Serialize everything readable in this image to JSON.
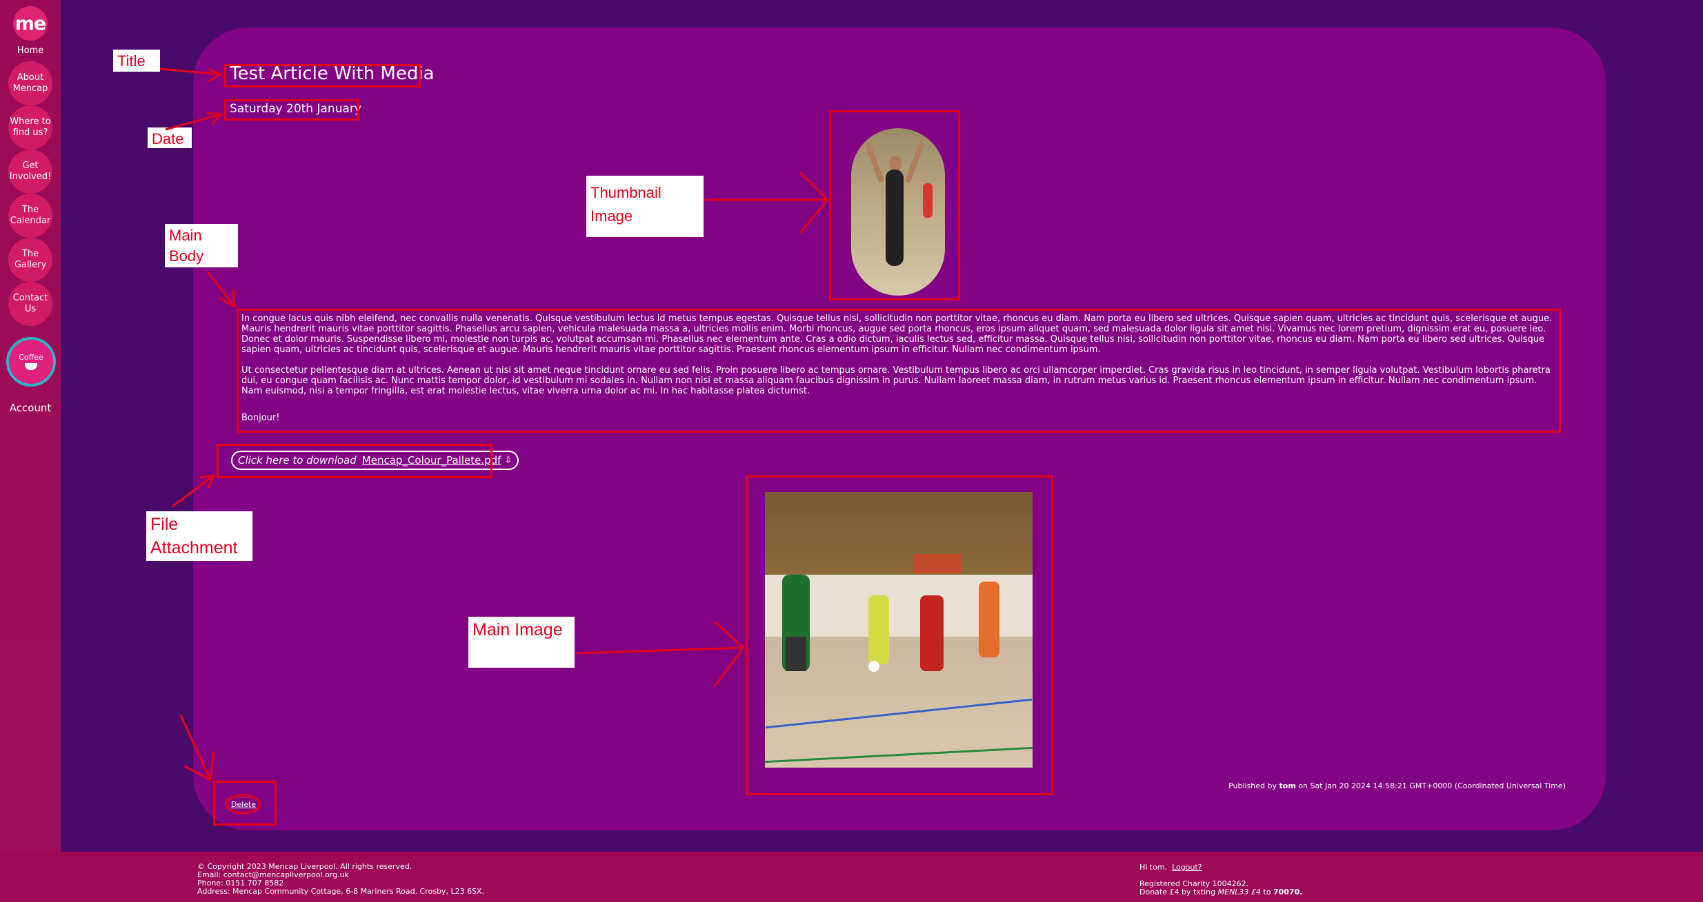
{
  "sidebar": {
    "logo": "me",
    "home_label": "Home",
    "items": [
      {
        "label": "About Mencap"
      },
      {
        "label": "Where to find us?"
      },
      {
        "label": "Get Involved!"
      },
      {
        "label": "The Calendar"
      },
      {
        "label": "The Gallery"
      },
      {
        "label": "Contact Us"
      }
    ],
    "coffee_badge": "Coffee",
    "account_label": "Account"
  },
  "article": {
    "title": "Test Article With Media",
    "date": "Saturday 20th January",
    "body_paragraphs": [
      "In congue lacus quis nibh eleifend, nec convallis nulla venenatis. Quisque vestibulum lectus id metus tempus egestas. Quisque tellus nisi, sollicitudin non porttitor vitae, rhoncus eu diam. Nam porta eu libero sed ultrices. Quisque sapien quam, ultricies ac tincidunt quis, scelerisque et augue. Mauris hendrerit mauris vitae porttitor sagittis. Phasellus arcu sapien, vehicula malesuada massa a, ultricies mollis enim. Morbi rhoncus, augue sed porta rhoncus, eros ipsum aliquet quam, sed malesuada dolor ligula sit amet nisi. Vivamus nec lorem pretium, dignissim erat eu, posuere leo. Donec et dolor mauris. Suspendisse libero mi, molestie non turpis ac, volutpat accumsan mi. Phasellus nec elementum ante. Cras a odio dictum, iaculis lectus sed, efficitur massa. Quisque tellus nisi, sollicitudin non porttitor vitae, rhoncus eu diam. Nam porta eu libero sed ultrices. Quisque sapien quam, ultricies ac tincidunt quis, scelerisque et augue. Mauris hendrerit mauris vitae porttitor sagittis. Praesent rhoncus elementum ipsum in efficitur. Nullam nec condimentum ipsum.",
      "Ut consectetur pellentesque diam at ultrices. Aenean ut nisi sit amet neque tincidunt ornare eu sed felis. Proin posuere libero ac tempus ornare. Vestibulum tempus libero ac orci ullamcorper imperdiet. Cras gravida risus in leo tincidunt, in semper ligula volutpat. Vestibulum lobortis pharetra dui, eu congue quam facilisis ac. Nunc mattis tempor dolor, id vestibulum mi sodales in. Nullam non nisi et massa aliquam faucibus dignissim in purus. Nullam laoreet massa diam, in rutrum metus varius id. Praesent rhoncus elementum ipsum in efficitur. Nullam nec condimentum ipsum. Nam euismod, nisi a tempor fringilla, est erat molestie lectus, vitae viverra urna dolor ac mi. In hac habitasse platea dictumst.",
      "Bonjour!"
    ],
    "download_lead": "Click here to download",
    "download_file": "Mencap_Colour_Pallete.pdf",
    "download_icon": "⇩",
    "published_prefix": "Published by",
    "published_author": "tom",
    "published_suffix": "on Sat Jan 20 2024 14:58:21 GMT+0000 (Coordinated Universal Time)",
    "delete_label": "Delete"
  },
  "annotations": {
    "title": "Title",
    "date": "Date",
    "thumbnail": "Thumbnail Image",
    "main_body": "Main Body",
    "file_attachment": "File Attachment",
    "main_image": "Main Image"
  },
  "footer": {
    "copyright": "© Copyright 2023 Mencap Liverpool. All rights reserved.",
    "email": "Email:  contact@mencapliverpool.org.uk",
    "phone": "Phone:  0151 707 8582",
    "address": "Address:  Mencap Community Cottage, 6-8 Mariners Road, Crosby, L23 6SX.",
    "greeting": "Hi tom,",
    "logout": "Logout?",
    "charity": "Registered Charity 1004262.",
    "donate_prefix": "Donate £4 by txting",
    "donate_code": "MENL33 £4",
    "donate_to": "to",
    "donate_number": "70070."
  },
  "colors": {
    "background": "#4a0a6a",
    "card": "#830385",
    "sidebar": "#9a0a55",
    "nav_button": "#d11c63",
    "annotation": "#e2001a"
  }
}
